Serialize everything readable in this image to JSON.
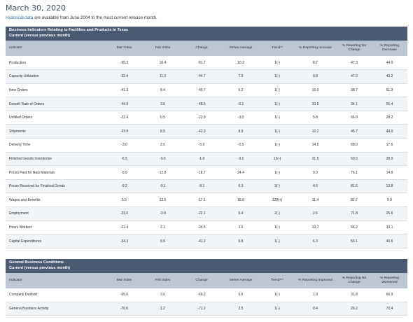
{
  "date": "March 30, 2020",
  "intro": {
    "link": "Historical data",
    "text": " are available from June 2004 to the most current release month."
  },
  "table1": {
    "title": "Business Indicators Relating to Facilities and Products in Texas",
    "subtitle": "Current (versus previous month)",
    "headers": [
      "Indicator",
      "Mar Index",
      "Feb Index",
      "Change",
      "Series Average",
      "Trend**",
      "% Reporting Increase",
      "% Reporting No Change",
      "% Reporting Decrease"
    ],
    "rows": [
      [
        "Production",
        "-35.3",
        "16.4",
        "-51.7",
        "10.2",
        "1(-)",
        "8.7",
        "47.3",
        "44.0"
      ],
      [
        "Capacity Utilization",
        "-33.4",
        "11.3",
        "-44.7",
        "7.9",
        "1(-)",
        "9.8",
        "47.0",
        "43.2"
      ],
      [
        "New Orders",
        "-41.3",
        "8.4",
        "-49.7",
        "6.2",
        "1(-)",
        "10.0",
        "38.7",
        "51.3"
      ],
      [
        "Growth Rate of Orders",
        "-44.9",
        "3.6",
        "-48.5",
        "-0.1",
        "1(-)",
        "10.5",
        "34.1",
        "55.4"
      ],
      [
        "Unfilled Orders",
        "-22.4",
        "0.5",
        "-22.9",
        "-3.0",
        "1(-)",
        "5.8",
        "66.0",
        "28.2"
      ],
      [
        "Shipments",
        "-33.8",
        "8.5",
        "-42.3",
        "8.9",
        "1(-)",
        "10.2",
        "45.7",
        "44.0"
      ],
      [
        "Delivery Time",
        "-3.0",
        "2.6",
        "-5.6",
        "-0.5",
        "1(-)",
        "14.5",
        "68.0",
        "17.5"
      ],
      [
        "Finished Goods Inventories",
        "-6.5",
        "-5.5",
        "-1.0",
        "-3.1",
        "12(-)",
        "21.5",
        "50.5",
        "28.0"
      ],
      [
        "Prices Paid for Raw Materials",
        "-5.9",
        "12.8",
        "-18.7",
        "24.4",
        "1(-)",
        "9.0",
        "76.1",
        "14.9"
      ],
      [
        "Prices Received for Finished Goods",
        "-9.2",
        "-0.1",
        "-9.1",
        "6.3",
        "3(-)",
        "4.6",
        "81.6",
        "13.8"
      ],
      [
        "Wages and Benefits",
        "5.5",
        "22.6",
        "-17.1",
        "18.8",
        "128(+)",
        "11.4",
        "82.7",
        "5.9"
      ],
      [
        "Employment",
        "-23.0",
        "-0.9",
        "-22.1",
        "6.4",
        "2(-)",
        "2.6",
        "71.8",
        "25.6"
      ],
      [
        "Hours Worked",
        "-22.4",
        "2.1",
        "-24.5",
        "2.6",
        "1(-)",
        "10.7",
        "56.2",
        "33.1"
      ],
      [
        "Capital Expenditures",
        "-34.3",
        "6.9",
        "-41.2",
        "6.8",
        "1(-)",
        "6.3",
        "53.1",
        "40.6"
      ]
    ]
  },
  "table2": {
    "title": "General Business Conditions",
    "subtitle": "Current (versus previous month)",
    "headers": [
      "Indicator",
      "Mar Index",
      "Feb Index",
      "Change",
      "Series Average",
      "Trend***",
      "% Reporting Improved",
      "% Reporting No Change",
      "% Reporting Worsened"
    ],
    "rows": [
      [
        "Company Outlook",
        "-65.6",
        "3.6",
        "-69.2",
        "6.8",
        "1(-)",
        "1.3",
        "31.8",
        "66.9"
      ],
      [
        "General Business Activity",
        "-70.0",
        "1.2",
        "-71.2",
        "2.5",
        "1(-)",
        "0.4",
        "29.2",
        "70.4"
      ]
    ]
  }
}
